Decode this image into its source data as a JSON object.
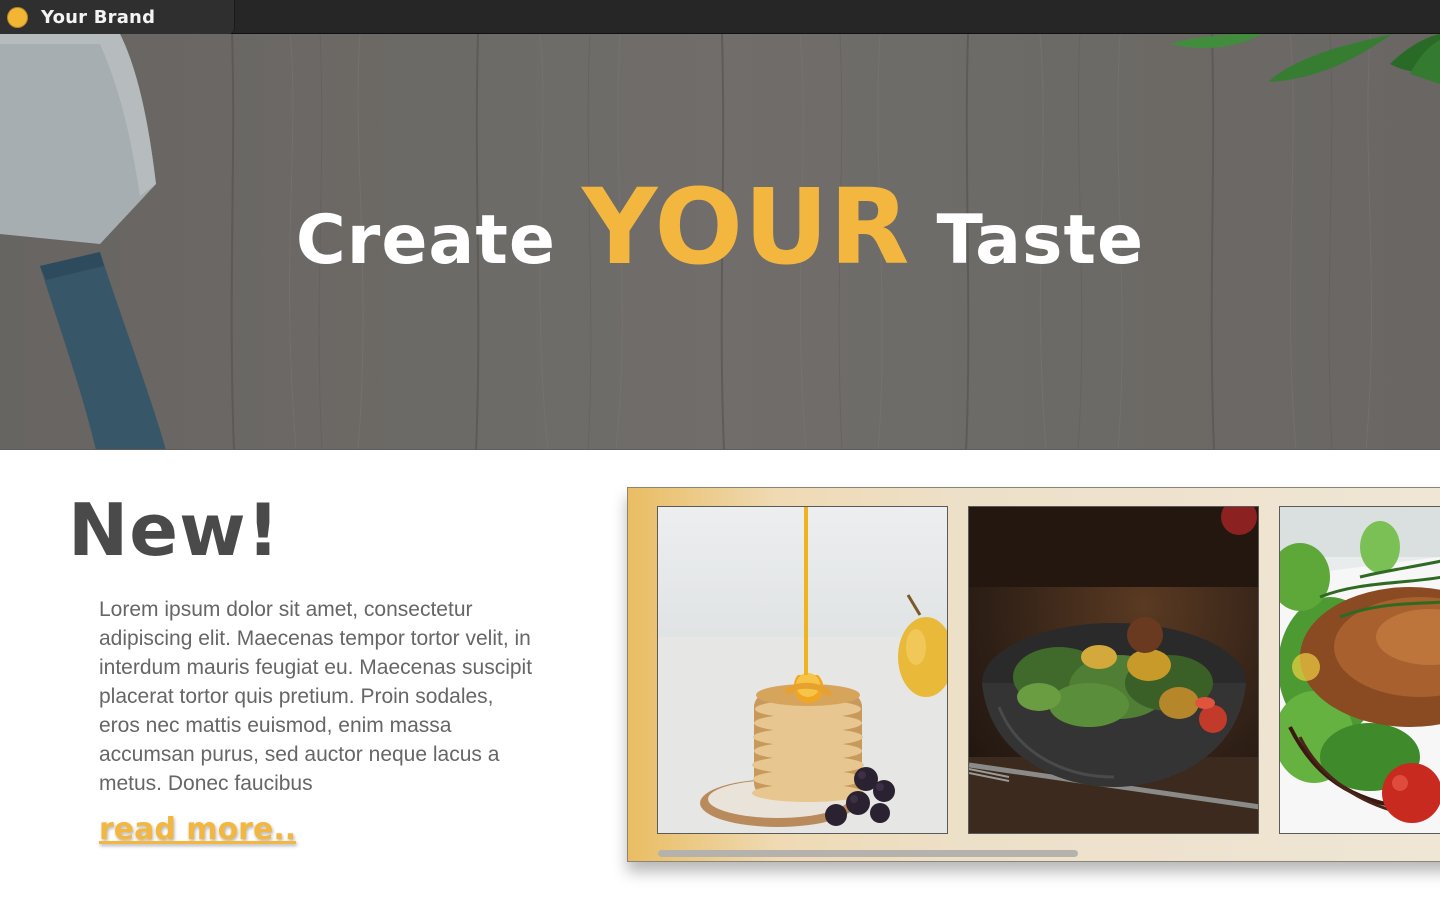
{
  "brand": {
    "name": "Your Brand",
    "dot_color": "#f2b634",
    "icon": "brand-dot-icon"
  },
  "hero": {
    "title_word_1": "Create",
    "title_word_2": "YOUR",
    "title_word_3": "Taste",
    "accent_color": "#f3b740"
  },
  "feature": {
    "heading": "New!",
    "body": "Lorem ipsum dolor sit amet, consectetur adipiscing elit. Maecenas tempor tortor velit, in interdum mauris feugiat eu. Maecenas suscipit placerat tortor quis pretium. Proin sodales, eros nec mattis euismod, enim massa accumsan purus, sed auctor neque lacus a metus. Donec faucibus",
    "link_label": "read more.."
  },
  "gallery": {
    "items": [
      {
        "icon": "pancakes-photo"
      },
      {
        "icon": "salad-bowl-photo"
      },
      {
        "icon": "salmon-plate-photo"
      }
    ]
  }
}
